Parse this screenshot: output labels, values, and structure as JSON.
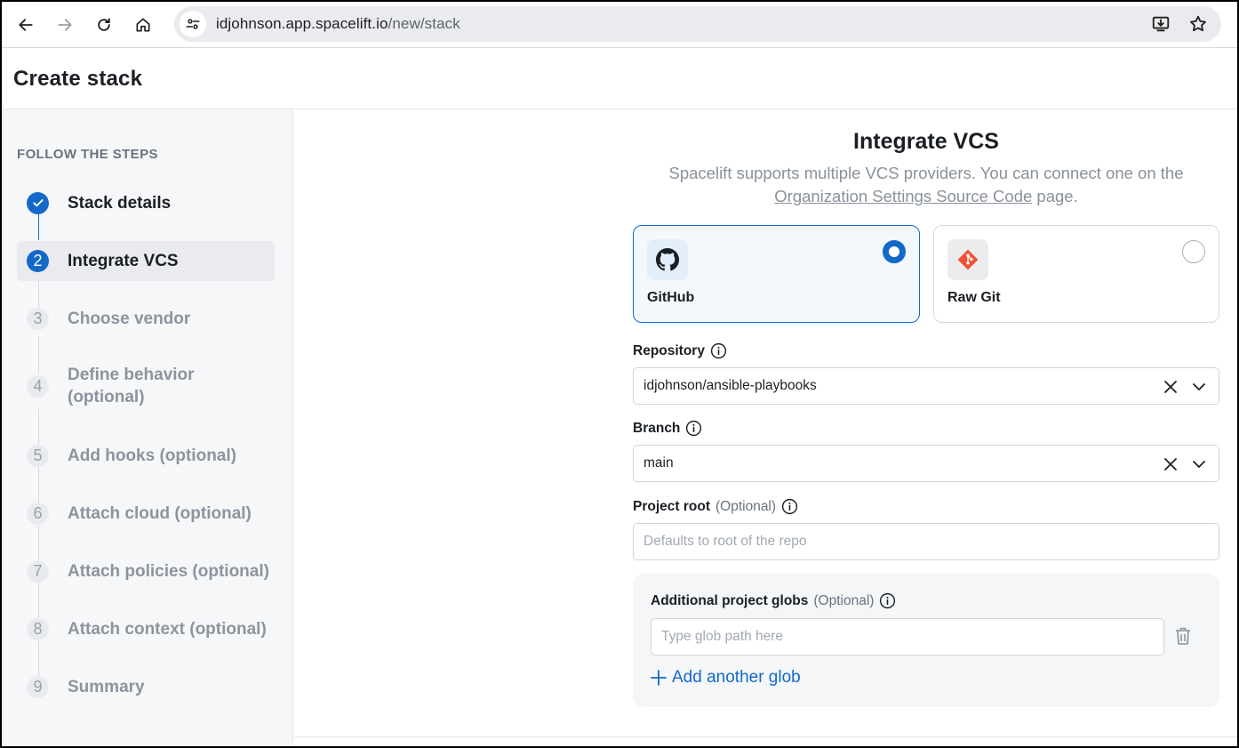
{
  "browser": {
    "url_host": "idjohnson.app.spacelift.io",
    "url_path": "/new/stack"
  },
  "header": {
    "title": "Create stack"
  },
  "sidebar": {
    "title": "FOLLOW THE STEPS",
    "steps": [
      {
        "number": "1",
        "label": "Stack details",
        "state": "done"
      },
      {
        "number": "2",
        "label": "Integrate VCS",
        "state": "current"
      },
      {
        "number": "3",
        "label": "Choose vendor",
        "state": "todo"
      },
      {
        "number": "4",
        "label": "Define behavior (optional)",
        "state": "todo"
      },
      {
        "number": "5",
        "label": "Add hooks (optional)",
        "state": "todo"
      },
      {
        "number": "6",
        "label": "Attach cloud (optional)",
        "state": "todo"
      },
      {
        "number": "7",
        "label": "Attach policies (optional)",
        "state": "todo"
      },
      {
        "number": "8",
        "label": "Attach context (optional)",
        "state": "todo"
      },
      {
        "number": "9",
        "label": "Summary",
        "state": "todo"
      }
    ]
  },
  "main": {
    "title": "Integrate VCS",
    "subtitle_prefix": "Spacelift supports multiple VCS providers. You can connect one on the",
    "subtitle_link": "Organization Settings Source Code",
    "subtitle_suffix": "page.",
    "providers": [
      {
        "name": "GitHub",
        "icon": "github-icon",
        "selected": true
      },
      {
        "name": "Raw Git",
        "icon": "git-icon",
        "selected": false
      }
    ],
    "repository": {
      "label": "Repository",
      "value": "idjohnson/ansible-playbooks"
    },
    "branch": {
      "label": "Branch",
      "value": "main"
    },
    "project_root": {
      "label": "Project root",
      "optional": "(Optional)",
      "placeholder": "Defaults to root of the repo"
    },
    "globs": {
      "label": "Additional project globs",
      "optional": "(Optional)",
      "placeholder": "Type glob path here",
      "add_label": "Add another glob"
    }
  },
  "colors": {
    "accent": "#1469c8",
    "git_brand": "#f05133"
  }
}
